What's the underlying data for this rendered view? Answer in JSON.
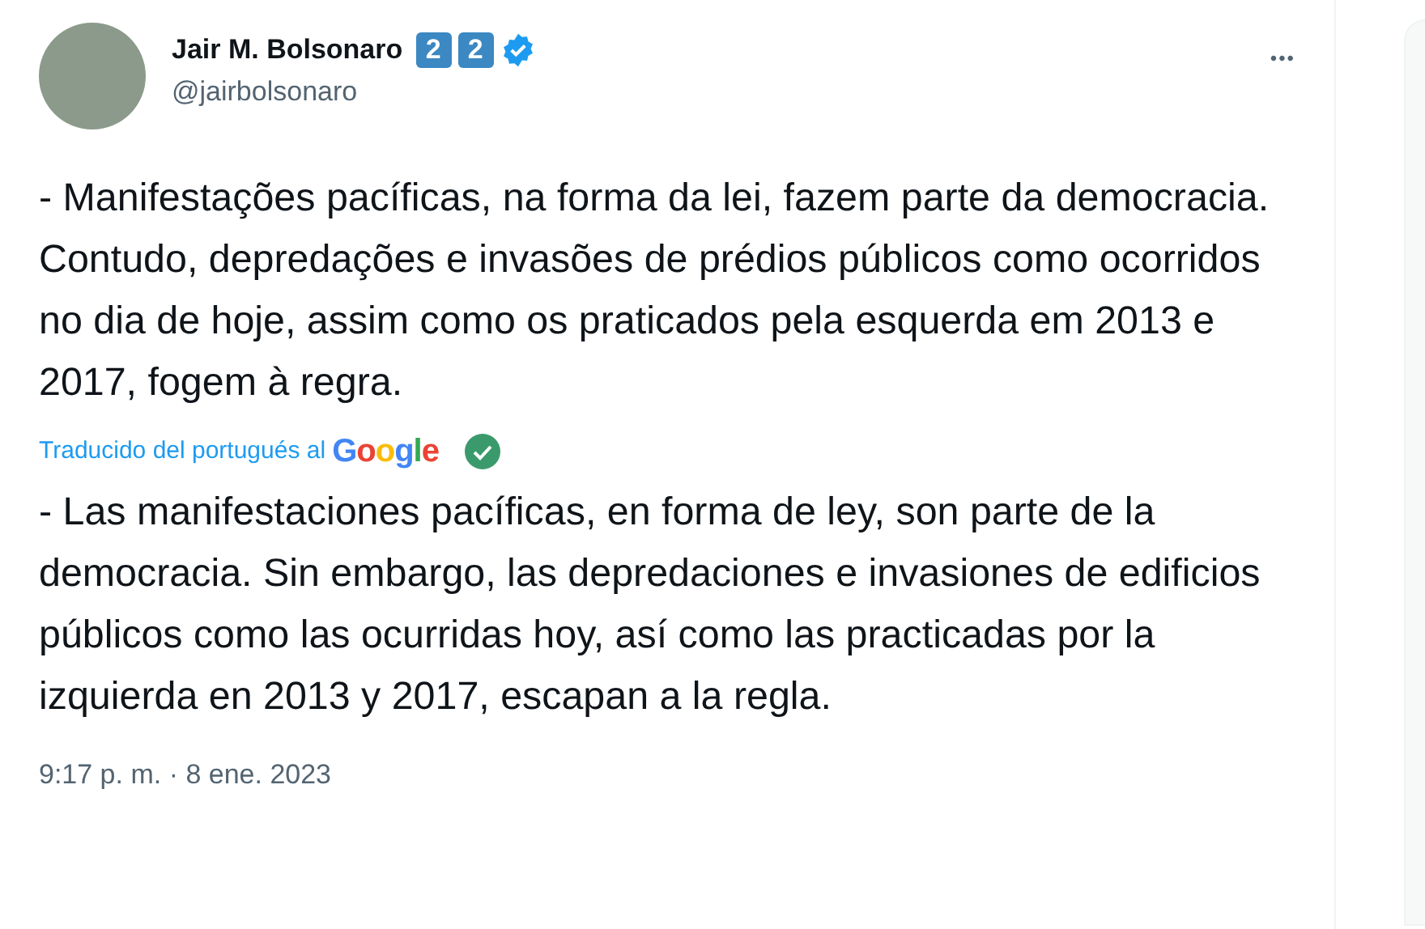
{
  "author": {
    "name": "Jair M. Bolsonaro",
    "keycaps": [
      "2",
      "2"
    ],
    "verified": true,
    "handle": "@jairbolsonaro"
  },
  "more_menu": "•••",
  "original_text": "- Manifestações pacíficas, na forma da lei, fazem parte da democracia. Contudo, depredações e invasões de prédios públicos como ocorridos no dia de hoje, assim como os praticados pela esquerda em 2013 e 2017, fogem à regra.",
  "translation": {
    "label": "Traducido del portugués al",
    "provider": "Google",
    "text": "- Las manifestaciones pacíficas, en forma de ley, son parte de la democracia. Sin embargo, las depredaciones e invasiones de edificios públicos como las ocurridas hoy, así como las practicadas por la izquierda en 2013 y 2017, escapan a la regla."
  },
  "timestamp": "9:17 p. m. · 8 ene. 2023"
}
